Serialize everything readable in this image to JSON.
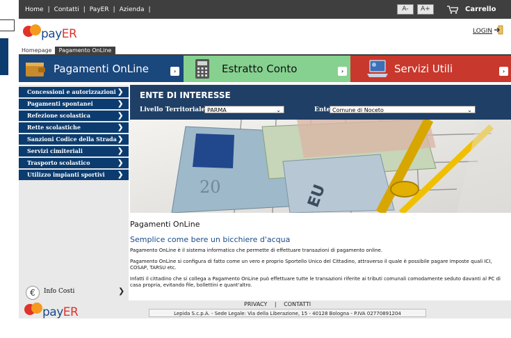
{
  "topbar": {
    "links": [
      "Home",
      "Contatti",
      "PayER",
      "Azienda"
    ],
    "font_small": "A-",
    "font_large": "A+",
    "cart": "Carrello",
    "cart_icon": "cart-icon"
  },
  "brand": {
    "pay": "pay",
    "er": "ER"
  },
  "header": {
    "login": "LOGIN",
    "login_icon": "login-arrow-icon"
  },
  "breadcrumb": {
    "home": "Homepage",
    "current": "Pagamento OnLine"
  },
  "tabs": [
    {
      "label": "Pagamenti OnLine",
      "icon": "wallet-icon",
      "arrow": "›"
    },
    {
      "label": "Estratto Conto",
      "icon": "calculator-icon",
      "arrow": "›"
    },
    {
      "label": "Servizi Utili",
      "icon": "laptop-icon",
      "arrow": "›"
    }
  ],
  "sidebar": {
    "items": [
      "Concessioni e autorizzazioni",
      "Pagamenti spontanei",
      "Refezione scolastica",
      "Rette scolastiche",
      "Sanzioni Codice della Strada",
      "Servizi cimiteriali",
      "Trasporto scolastico",
      "Utilizzo impianti sportivi"
    ],
    "chevron": "❯",
    "info": {
      "label": "Info Costi",
      "symbol": "€",
      "chevron": "❯"
    }
  },
  "ente": {
    "title": "ENTE DI INTERESSE",
    "livello_label": "Livello Territoriale",
    "livello_value": "PARMA",
    "ente_label": "Ente",
    "ente_value": "Comune di Noceto",
    "caret": "⌄"
  },
  "content": {
    "title": "Pagamenti OnLine",
    "subtitle": "Semplice come bere un bicchiere d'acqua",
    "p1": "Pagamento OnLine è il sistema informatico che permette di effettuare transazioni di pagamento online.",
    "p2": "Pagamento OnLine si configura di fatto come un vero e proprio Sportello Unico del Cittadino, attraverso il quale è possibile pagare imposte quali ICI, COSAP, TARSU etc.",
    "p3": "Infatti il cittadino che si collega a Pagamento OnLine può effettuare tutte le transazioni riferite ai tributi comunali comodamente seduto davanti al PC di casa propria, evitando file, bollettini e quant'altro."
  },
  "footer": {
    "privacy": "PRIVACY",
    "sep": "|",
    "contatti": "CONTATTI",
    "legal": "Lepida S.c.p.A. - Sede Legale: Via della Liberazione, 15 - 40128 Bologna - P.IVA 02770891204"
  },
  "colors": {
    "topbar": "#3f3f3f",
    "nav_blue": "#0c3c6f",
    "ente_blue": "#1f3f66",
    "tab_green": "#86d18f",
    "tab_red": "#c8382c",
    "brand_red": "#e0332a",
    "brand_orange": "#f59a1e"
  }
}
